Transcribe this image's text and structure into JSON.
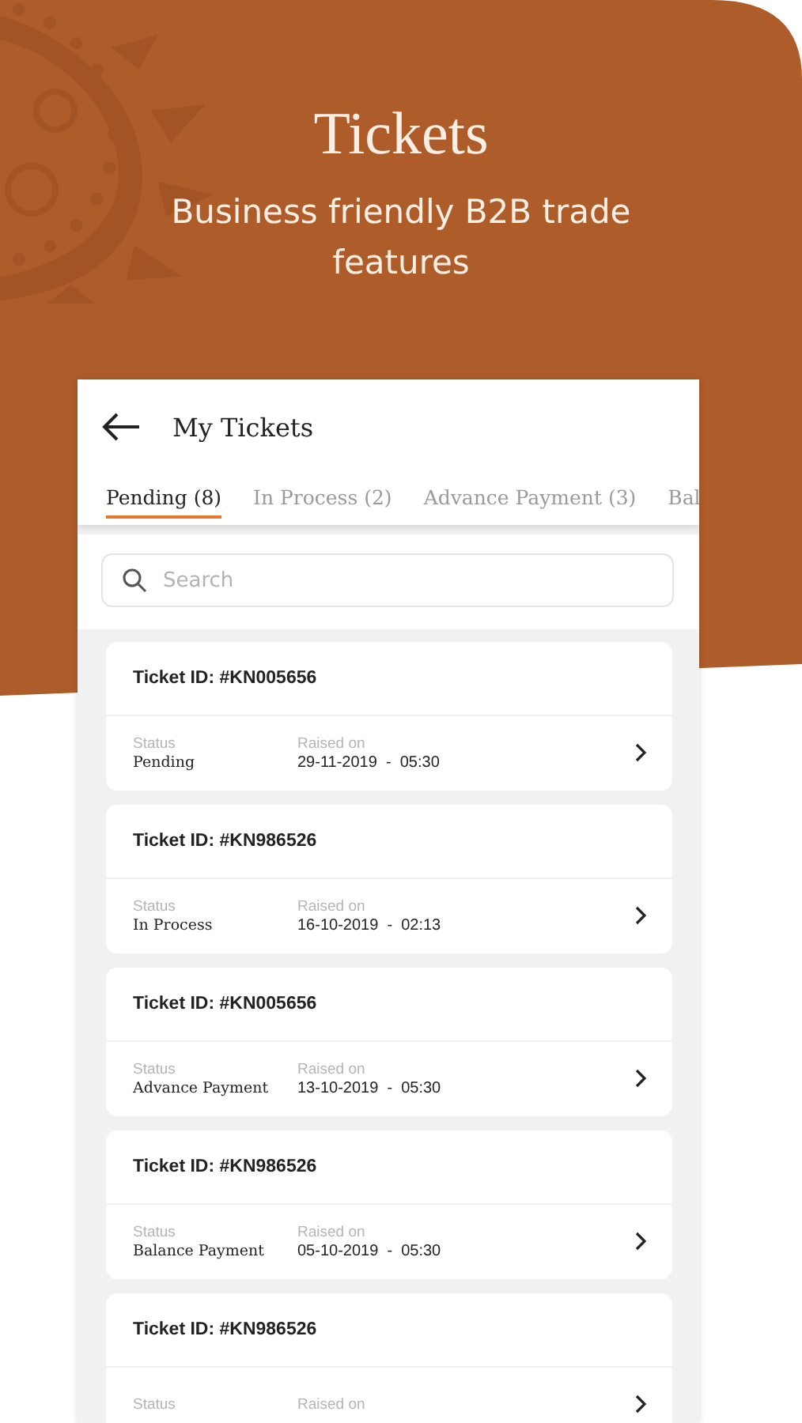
{
  "banner": {
    "title": "Tickets",
    "subtitle": "Business friendly B2B trade features"
  },
  "screen": {
    "title": "My Tickets",
    "tabs": [
      {
        "label": "Pending (8)",
        "selected": true
      },
      {
        "label": "In Process (2)",
        "selected": false
      },
      {
        "label": "Advance Payment (3)",
        "selected": false
      },
      {
        "label": "Bal",
        "selected": false
      }
    ],
    "search": {
      "placeholder": "Search"
    },
    "tickets": [
      {
        "id": "Ticket ID: #KN005656",
        "status_label": "Status",
        "status": "Pending",
        "raised_label": "Raised on",
        "raised": "29-11-2019  -  05:30"
      },
      {
        "id": "Ticket ID: #KN986526",
        "status_label": "Status",
        "status": "In Process",
        "raised_label": "Raised on",
        "raised": "16-10-2019  -  02:13"
      },
      {
        "id": "Ticket ID: #KN005656",
        "status_label": "Status",
        "status": "Advance Payment",
        "raised_label": "Raised on",
        "raised": "13-10-2019  -  05:30"
      },
      {
        "id": "Ticket ID: #KN986526",
        "status_label": "Status",
        "status": "Balance Payment",
        "raised_label": "Raised on",
        "raised": "05-10-2019  -  05:30"
      },
      {
        "id": "Ticket ID: #KN986526",
        "status_label": "Status",
        "raised_label": "Raised on"
      }
    ]
  }
}
